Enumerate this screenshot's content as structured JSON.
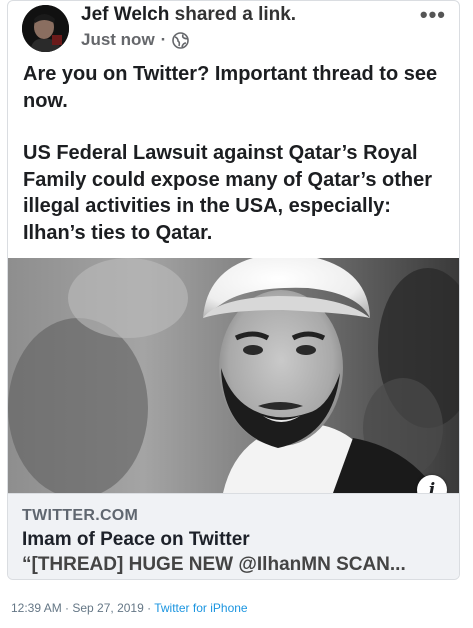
{
  "post": {
    "author": "Jef Welch",
    "action": "shared a link.",
    "time": "Just now",
    "separator": "·",
    "audience_icon": "globe-icon",
    "more_icon": "more-options-icon",
    "more_glyph": "•••",
    "text_paragraphs": [
      "Are you on Twitter? Important thread to see now.",
      "US Federal Lawsuit against Qatar’s Royal Family could expose many of Qatar’s other illegal activities in the USA, especially: Ilhan’s ties to Qatar."
    ]
  },
  "link_preview": {
    "info_icon": "info-icon",
    "info_glyph": "i",
    "domain": "TWITTER.COM",
    "title": "Imam of Peace on Twitter",
    "description": "“[THREAD] HUGE NEW @IlhanMN SCAN..."
  },
  "tweet_footer": {
    "timestamp": "12:39 AM · Sep 27, 2019 · ",
    "source": "Twitter for iPhone"
  }
}
